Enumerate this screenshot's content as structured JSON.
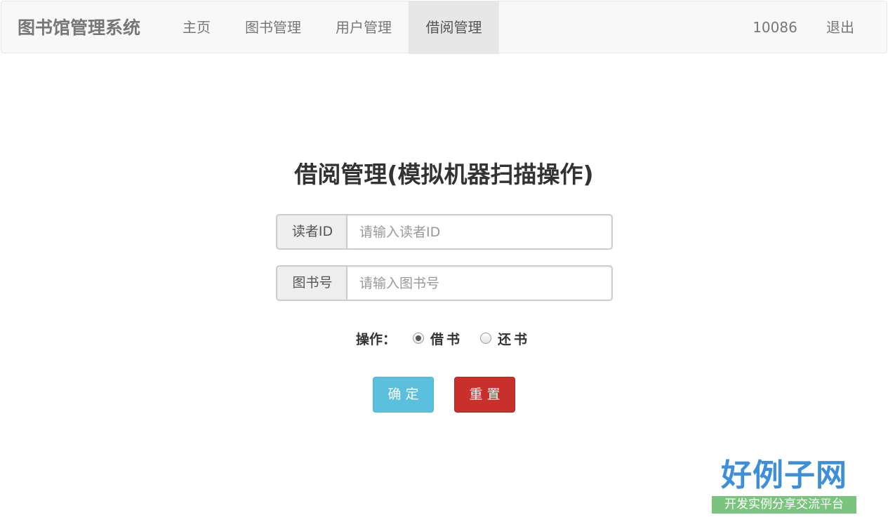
{
  "navbar": {
    "brand": "图书馆管理系统",
    "items": [
      {
        "label": "主页"
      },
      {
        "label": "图书管理"
      },
      {
        "label": "用户管理"
      },
      {
        "label": "借阅管理",
        "active": true
      }
    ],
    "user": "10086",
    "logout": "退出"
  },
  "page": {
    "title": "借阅管理(模拟机器扫描操作)"
  },
  "form": {
    "reader": {
      "label": "读者ID",
      "placeholder": "请输入读者ID",
      "value": ""
    },
    "book": {
      "label": "图书号",
      "placeholder": "请输入图书号",
      "value": ""
    },
    "operation": {
      "label": "操作：",
      "options": [
        {
          "label": "借书",
          "checked": true
        },
        {
          "label": "还书",
          "checked": false
        }
      ]
    },
    "confirm_label": "确定",
    "reset_label": "重置"
  },
  "watermark": {
    "main": "好例子网",
    "sub": "开发实例分享交流平台"
  },
  "colors": {
    "navbar_bg": "#f8f8f8",
    "nav_active_bg": "#e7e7e7",
    "confirm_button": "#5bc0de",
    "reset_button": "#c9302c",
    "watermark_blue": "#3d8fd9",
    "watermark_green": "#7bc47f"
  }
}
